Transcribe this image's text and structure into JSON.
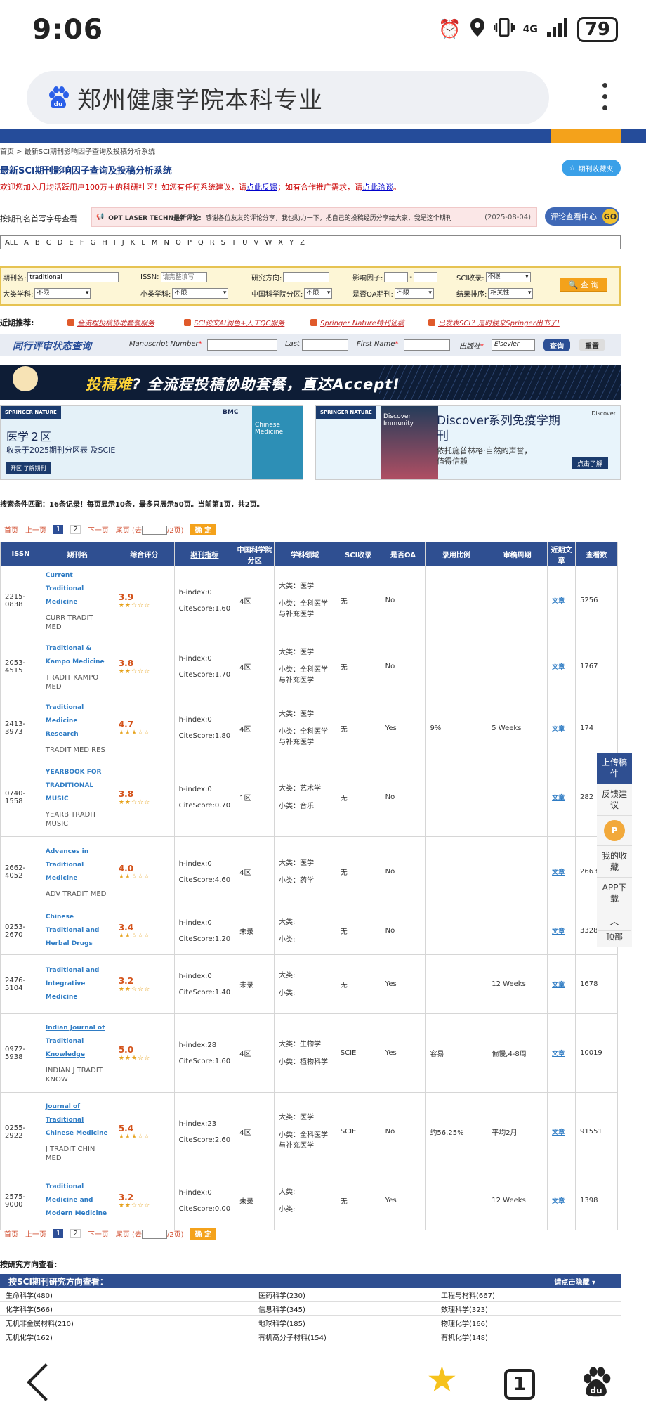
{
  "status": {
    "time": "9:06",
    "network": "4G",
    "battery": "79"
  },
  "browser": {
    "address_title": "郑州健康学院本科专业"
  },
  "site": {
    "breadcrumb": "首页 > 最新SCI期刊影响因子查询及投稿分析系统",
    "heading": "最新SCI期刊影响因子查询及投稿分析系统",
    "fav_button": "期刊收藏夹",
    "welcome": {
      "a": "欢迎您加入月均活跃用户100万＋的科研社区！如您有任何系统建议，请",
      "b": "点此反馈",
      "c": "；如有合作推广需求，请",
      "d": "点此洽谈",
      "e": "。"
    },
    "comment": {
      "label": "按期刊名首写字母查看",
      "journal": "OPT LASER TECHN最新评论:",
      "text": "感谢各位友友的评论分享，我也助力一下，把自己的投稿经历分享给大家，我是这个期刊",
      "date": "(2025-08-04)",
      "button": "评论查看中心",
      "go": "GO"
    },
    "letters": [
      "ALL",
      "A",
      "B",
      "C",
      "D",
      "E",
      "F",
      "G",
      "H",
      "I",
      "J",
      "K",
      "L",
      "M",
      "N",
      "O",
      "P",
      "Q",
      "R",
      "S",
      "T",
      "U",
      "V",
      "W",
      "X",
      "Y",
      "Z"
    ],
    "search": {
      "name_label": "期刊名:",
      "name_value": "traditional",
      "issn_label": "ISSN:",
      "issn_placeholder": "请完整填写",
      "dir_label": "研究方向:",
      "if_label": "影响因子:",
      "sci_label": "SCI收录:",
      "sci_value": "不限",
      "major_label": "大类学科:",
      "major_value": "不限",
      "minor_label": "小类学科:",
      "minor_value": "不限",
      "cas_label": "中国科学院分区:",
      "cas_value": "不限",
      "oa_label": "是否OA期刊:",
      "oa_value": "不限",
      "sort_label": "结果排序:",
      "sort_value": "相关性",
      "button": "查 询"
    },
    "recommend": {
      "label": "近期推荐:",
      "links": [
        "全流程投稿协助套餐服务",
        "SCI论文AI润色+人工QC服务",
        "Springer Nature特刊征稿",
        "已发表SCI？是时候来Springer出书了!"
      ]
    },
    "peer": {
      "title": "同行评审状态查询",
      "mn": "Manuscript Number",
      "ln": "Last Name",
      "fn": "First Name",
      "pub": "出版社",
      "pub_value": "Elsevier",
      "query": "查询",
      "reset": "重置"
    },
    "banner": {
      "part1": "投稿难",
      "part2": "? 全流程投稿协助套餐，直达Accept!"
    },
    "ad1": {
      "brand": "SPRINGER NATURE",
      "bmc": "BMC",
      "big": "医学２区",
      "sub": "收录于2025期刊分区表 及SCIE",
      "btn": "开区 了解期刊",
      "book": "Chinese Medicine"
    },
    "ad2": {
      "brand": "SPRINGER NATURE",
      "book": "Discover Immunity",
      "big": "Discover系列免疫学期刊",
      "sub1": "依托施普林格·自然的声誉，",
      "sub2": "值得信赖",
      "btn": "点击了解",
      "logo": "Discover"
    },
    "summary": "搜索条件匹配：16条记录！每页显示10条，最多只展示50页。当前第1页，共2页。",
    "pager": {
      "first": "首页",
      "prev": "上一页",
      "p1": "1",
      "p2": "2",
      "next": "下一页",
      "last": "尾页",
      "go_pre": "(去",
      "go_post": "/2页)",
      "ok": "确 定"
    },
    "columns": [
      "ISSN",
      "期刊名",
      "综合评分",
      "期刊指标",
      "中国科学院分区",
      "学科领域",
      "SCI收录",
      "是否OA",
      "录用比例",
      "审稿周期",
      "近期文章",
      "查看数"
    ],
    "rows": [
      {
        "issn": "2215-0838",
        "name": "Current Traditional Medicine",
        "abbr": "CURR TRADIT MED",
        "score": "3.9",
        "stars": "★★☆☆☆",
        "h": "h-index:0",
        "cs": "CiteScore:1.60",
        "cas": "4区",
        "major": "大类：医学",
        "minor": "小类：全科医学与补充医学",
        "sci": "无",
        "oa": "No",
        "rate": "",
        "cycle": "",
        "art": "文章",
        "views": "5256"
      },
      {
        "issn": "2053-4515",
        "name": "Traditional & Kampo Medicine",
        "abbr": "TRADIT KAMPO MED",
        "score": "3.8",
        "stars": "★★☆☆☆",
        "h": "h-index:0",
        "cs": "CiteScore:1.70",
        "cas": "4区",
        "major": "大类：医学",
        "minor": "小类：全科医学与补充医学",
        "sci": "无",
        "oa": "No",
        "rate": "",
        "cycle": "",
        "art": "文章",
        "views": "1767"
      },
      {
        "issn": "2413-3973",
        "name": "Traditional Medicine Research",
        "abbr": "TRADIT MED RES",
        "score": "4.7",
        "stars": "★★★☆☆",
        "h": "h-index:0",
        "cs": "CiteScore:1.80",
        "cas": "4区",
        "major": "大类：医学",
        "minor": "小类：全科医学与补充医学",
        "sci": "无",
        "oa": "Yes",
        "rate": "9%",
        "cycle": "5 Weeks",
        "art": "文章",
        "views": "174"
      },
      {
        "issn": "0740-1558",
        "name": "YEARBOOK FOR TRADITIONAL MUSIC",
        "abbr": "YEARB TRADIT MUSIC",
        "score": "3.8",
        "stars": "★★☆☆☆",
        "h": "h-index:0",
        "cs": "CiteScore:0.70",
        "cas": "1区",
        "major": "大类：艺术学",
        "minor": "小类：音乐",
        "sci": "无",
        "oa": "No",
        "rate": "",
        "cycle": "",
        "art": "文章",
        "views": "282"
      },
      {
        "issn": "2662-4052",
        "name": "Advances in Traditional Medicine",
        "abbr": "ADV TRADIT MED",
        "score": "4.0",
        "stars": "★★☆☆☆",
        "h": "h-index:0",
        "cs": "CiteScore:4.60",
        "cas": "4区",
        "major": "大类：医学",
        "minor": "小类：药学",
        "sci": "无",
        "oa": "No",
        "rate": "",
        "cycle": "",
        "art": "文章",
        "views": "2663"
      },
      {
        "issn": "0253-2670",
        "name": "Chinese Traditional and Herbal Drugs",
        "abbr": "",
        "score": "3.4",
        "stars": "★★☆☆☆",
        "h": "h-index:0",
        "cs": "CiteScore:1.20",
        "cas": "未录",
        "major": "大类:",
        "minor": "小类:",
        "sci": "无",
        "oa": "No",
        "rate": "",
        "cycle": "",
        "art": "文章",
        "views": "3328"
      },
      {
        "issn": "2476-5104",
        "name": "Traditional and Integrative Medicine",
        "abbr": "",
        "score": "3.2",
        "stars": "★★☆☆☆",
        "h": "h-index:0",
        "cs": "CiteScore:1.40",
        "cas": "未录",
        "major": "大类:",
        "minor": "小类:",
        "sci": "无",
        "oa": "Yes",
        "rate": "",
        "cycle": "12 Weeks",
        "art": "文章",
        "views": "1678"
      },
      {
        "issn": "0972-5938",
        "name": "Indian Journal of Traditional Knowledge",
        "abbr": "INDIAN J TRADIT KNOW",
        "score": "5.0",
        "stars": "★★★☆☆",
        "h": "h-index:28",
        "cs": "CiteScore:1.60",
        "cas": "4区",
        "major": "大类：生物学",
        "minor": "小类：植物科学",
        "sci": "SCIE",
        "oa": "Yes",
        "rate": "容易",
        "cycle": "偏慢,4-8周",
        "art": "文章",
        "views": "10019"
      },
      {
        "issn": "0255-2922",
        "name": "Journal of Traditional Chinese Medicine",
        "abbr": "J TRADIT CHIN MED",
        "score": "5.4",
        "stars": "★★★☆☆",
        "h": "h-index:23",
        "cs": "CiteScore:2.60",
        "cas": "4区",
        "major": "大类：医学",
        "minor": "小类：全科医学与补充医学",
        "sci": "SCIE",
        "oa": "No",
        "rate": "约56.25%",
        "cycle": "平均2月",
        "art": "文章",
        "views": "91551"
      },
      {
        "issn": "2575-9000",
        "name": "Traditional Medicine and Modern Medicine",
        "abbr": "",
        "score": "3.2",
        "stars": "★★☆☆☆",
        "h": "h-index:0",
        "cs": "CiteScore:0.00",
        "cas": "未录",
        "major": "大类:",
        "minor": "小类:",
        "sci": "无",
        "oa": "Yes",
        "rate": "",
        "cycle": "12 Weeks",
        "art": "文章",
        "views": "1398"
      }
    ],
    "direction": {
      "label": "按研究方向查看:",
      "head": "按SCI期刊研究方向查看：",
      "toggle": "请点击隐藏 ▾",
      "items": [
        "生命科学(480)",
        "医药科学(230)",
        "工程与材料(667)",
        "化学科学(566)",
        "信息科学(345)",
        "数理科学(323)",
        "无机非金属材料(210)",
        "地球科学(185)",
        "物理化学(166)",
        "无机化学(162)",
        "有机高分子材料(154)",
        "有机化学(148)"
      ]
    },
    "side": [
      "上传稿件",
      "反馈建议",
      "",
      "我的收藏",
      "APP下载",
      "顶部"
    ]
  }
}
